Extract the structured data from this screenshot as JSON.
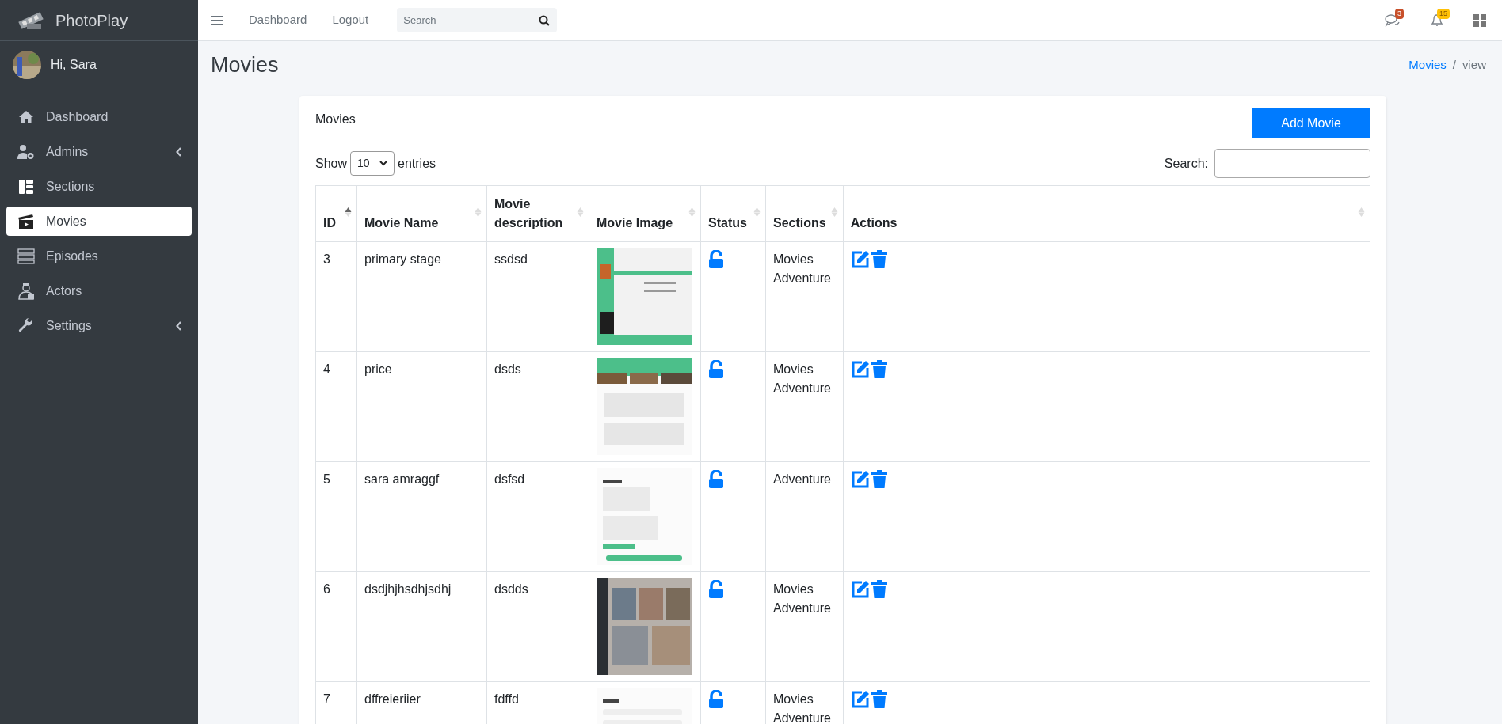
{
  "brand": "PhotoPlay",
  "user": {
    "greeting": "Hi, Sara"
  },
  "sidebar": {
    "items": [
      {
        "label": "Dashboard",
        "submenu": false,
        "selected": false
      },
      {
        "label": "Admins",
        "submenu": true,
        "selected": false
      },
      {
        "label": "Sections",
        "submenu": false,
        "selected": false
      },
      {
        "label": "Movies",
        "submenu": false,
        "selected": true
      },
      {
        "label": "Episodes",
        "submenu": false,
        "selected": false
      },
      {
        "label": "Actors",
        "submenu": false,
        "selected": false
      },
      {
        "label": "Settings",
        "submenu": true,
        "selected": false
      }
    ]
  },
  "topbar": {
    "links": [
      "Dashboard",
      "Logout"
    ],
    "search": {
      "placeholder": "Search"
    },
    "messages_badge": "3",
    "notifications_badge": "15"
  },
  "page": {
    "title": "Movies",
    "breadcrumb": [
      {
        "label": "Movies",
        "link": true
      },
      {
        "label": "view",
        "link": false
      }
    ],
    "breadcrumb_separator": "/"
  },
  "card": {
    "title": "Movies",
    "add_button": "Add Movie",
    "show_label": "Show",
    "page_size": "10",
    "entries_label": "entries",
    "search_label": "Search:"
  },
  "table": {
    "columns": [
      {
        "label": "ID",
        "sorted": true
      },
      {
        "label": "Movie Name",
        "sorted": false
      },
      {
        "label": "Movie description",
        "sorted": false
      },
      {
        "label": "Movie Image",
        "sorted": false
      },
      {
        "label": "Status",
        "sorted": false
      },
      {
        "label": "Sections",
        "sorted": false
      },
      {
        "label": "Actions",
        "sorted": false
      }
    ],
    "rows": [
      {
        "id": "3",
        "name": "primary stage",
        "description": "ssdsd",
        "locked": false,
        "sections": [
          "Movies",
          "Adventure"
        ]
      },
      {
        "id": "4",
        "name": "price",
        "description": "dsds",
        "locked": false,
        "sections": [
          "Movies",
          "Adventure"
        ]
      },
      {
        "id": "5",
        "name": "sara amraggf",
        "description": "dsfsd",
        "locked": false,
        "sections": [
          "Adventure"
        ]
      },
      {
        "id": "6",
        "name": "dsdjhjhsdhjsdhj",
        "description": "dsdds",
        "locked": false,
        "sections": [
          "Movies",
          "Adventure"
        ]
      },
      {
        "id": "7",
        "name": "dffreieriier",
        "description": "fdffd",
        "locked": false,
        "sections": [
          "Movies",
          "Adventure"
        ]
      }
    ]
  }
}
